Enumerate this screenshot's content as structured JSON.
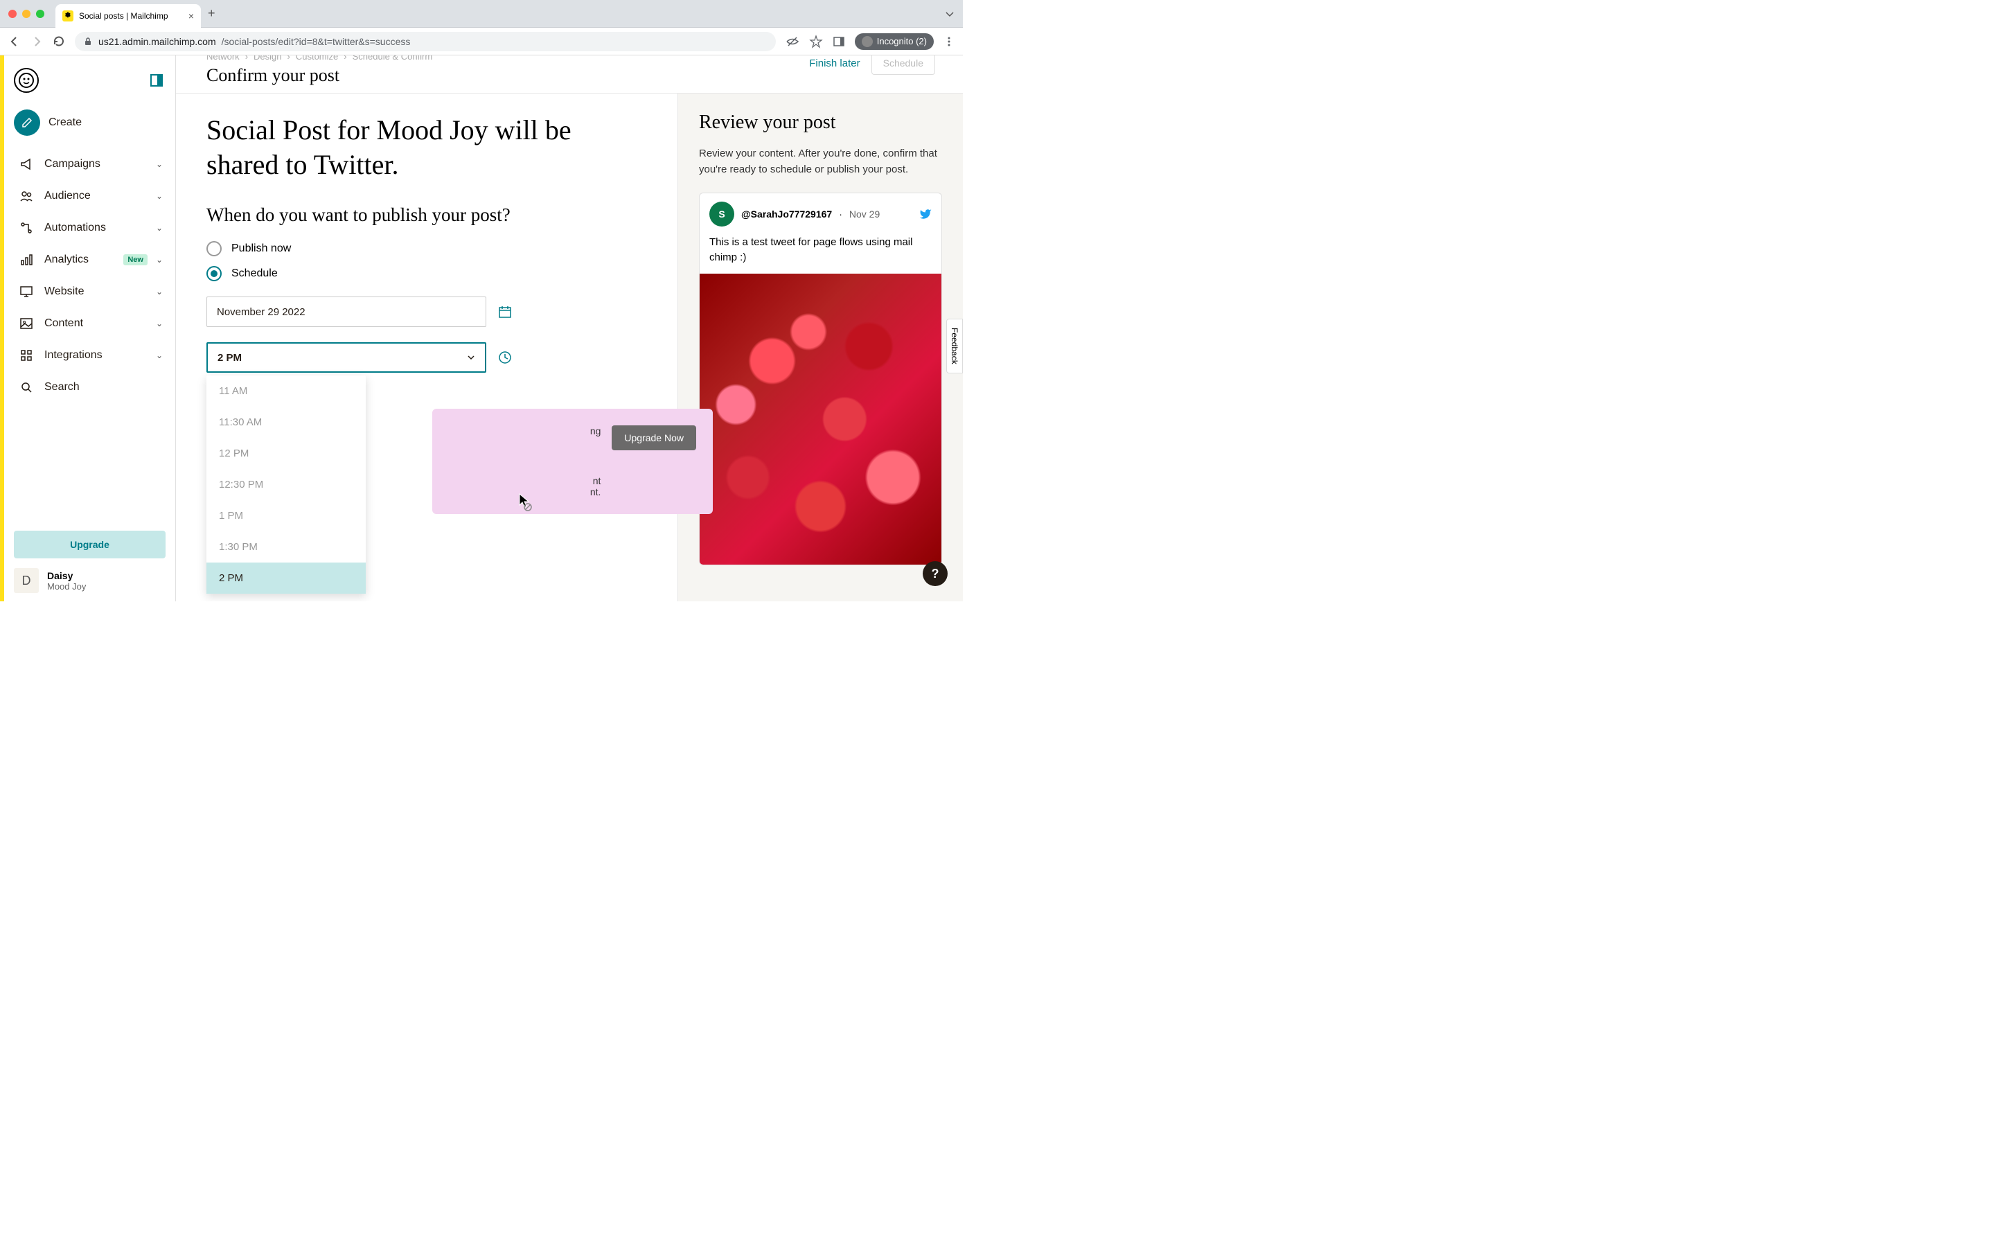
{
  "browser": {
    "tab_title": "Social posts | Mailchimp",
    "url_host": "us21.admin.mailchimp.com",
    "url_path": "/social-posts/edit?id=8&t=twitter&s=success",
    "incognito_label": "Incognito (2)"
  },
  "sidebar": {
    "create": "Create",
    "items": [
      {
        "label": "Campaigns"
      },
      {
        "label": "Audience"
      },
      {
        "label": "Automations"
      },
      {
        "label": "Analytics",
        "badge": "New"
      },
      {
        "label": "Website"
      },
      {
        "label": "Content"
      },
      {
        "label": "Integrations"
      }
    ],
    "search": "Search",
    "upgrade": "Upgrade",
    "account_initial": "D",
    "account_name": "Daisy",
    "account_sub": "Mood Joy"
  },
  "breadcrumbs": [
    "Network",
    "Design",
    "Customize",
    "Schedule & Confirm"
  ],
  "top": {
    "confirm_title": "Confirm your post",
    "finish_later": "Finish later",
    "schedule": "Schedule"
  },
  "main": {
    "headline": "Social Post for Mood Joy will be shared to Twitter.",
    "subhead": "When do you want to publish your post?",
    "option_now": "Publish now",
    "option_schedule": "Schedule",
    "date_value": "November 29 2022",
    "time_value": "2 PM",
    "dropdown": [
      "11 AM",
      "11:30 AM",
      "12 PM",
      "12:30 PM",
      "1 PM",
      "1:30 PM",
      "2 PM"
    ],
    "selected_time": "2 PM",
    "upgrade_text_1": "ng",
    "upgrade_text_2": "nt",
    "upgrade_text_3": "nt.",
    "upgrade_cta": "Upgrade Now"
  },
  "preview": {
    "title": "Review your post",
    "desc": "Review your content. After you're done, confirm that you're ready to schedule or publish your post.",
    "avatar_initial": "S",
    "handle": "@SarahJo77729167",
    "date": "Nov 29",
    "body": "This is a test tweet for page flows using mail chimp :)"
  },
  "feedback": "Feedback",
  "help": "?"
}
